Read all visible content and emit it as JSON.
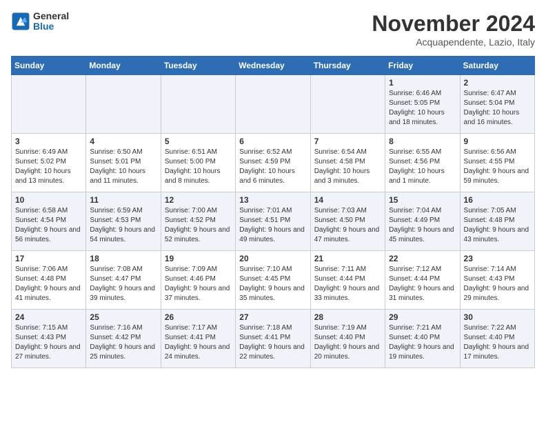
{
  "logo": {
    "line1": "General",
    "line2": "Blue"
  },
  "title": "November 2024",
  "location": "Acquapendente, Lazio, Italy",
  "days_of_week": [
    "Sunday",
    "Monday",
    "Tuesday",
    "Wednesday",
    "Thursday",
    "Friday",
    "Saturday"
  ],
  "weeks": [
    [
      {
        "day": "",
        "info": ""
      },
      {
        "day": "",
        "info": ""
      },
      {
        "day": "",
        "info": ""
      },
      {
        "day": "",
        "info": ""
      },
      {
        "day": "",
        "info": ""
      },
      {
        "day": "1",
        "info": "Sunrise: 6:46 AM\nSunset: 5:05 PM\nDaylight: 10 hours and 18 minutes."
      },
      {
        "day": "2",
        "info": "Sunrise: 6:47 AM\nSunset: 5:04 PM\nDaylight: 10 hours and 16 minutes."
      }
    ],
    [
      {
        "day": "3",
        "info": "Sunrise: 6:49 AM\nSunset: 5:02 PM\nDaylight: 10 hours and 13 minutes."
      },
      {
        "day": "4",
        "info": "Sunrise: 6:50 AM\nSunset: 5:01 PM\nDaylight: 10 hours and 11 minutes."
      },
      {
        "day": "5",
        "info": "Sunrise: 6:51 AM\nSunset: 5:00 PM\nDaylight: 10 hours and 8 minutes."
      },
      {
        "day": "6",
        "info": "Sunrise: 6:52 AM\nSunset: 4:59 PM\nDaylight: 10 hours and 6 minutes."
      },
      {
        "day": "7",
        "info": "Sunrise: 6:54 AM\nSunset: 4:58 PM\nDaylight: 10 hours and 3 minutes."
      },
      {
        "day": "8",
        "info": "Sunrise: 6:55 AM\nSunset: 4:56 PM\nDaylight: 10 hours and 1 minute."
      },
      {
        "day": "9",
        "info": "Sunrise: 6:56 AM\nSunset: 4:55 PM\nDaylight: 9 hours and 59 minutes."
      }
    ],
    [
      {
        "day": "10",
        "info": "Sunrise: 6:58 AM\nSunset: 4:54 PM\nDaylight: 9 hours and 56 minutes."
      },
      {
        "day": "11",
        "info": "Sunrise: 6:59 AM\nSunset: 4:53 PM\nDaylight: 9 hours and 54 minutes."
      },
      {
        "day": "12",
        "info": "Sunrise: 7:00 AM\nSunset: 4:52 PM\nDaylight: 9 hours and 52 minutes."
      },
      {
        "day": "13",
        "info": "Sunrise: 7:01 AM\nSunset: 4:51 PM\nDaylight: 9 hours and 49 minutes."
      },
      {
        "day": "14",
        "info": "Sunrise: 7:03 AM\nSunset: 4:50 PM\nDaylight: 9 hours and 47 minutes."
      },
      {
        "day": "15",
        "info": "Sunrise: 7:04 AM\nSunset: 4:49 PM\nDaylight: 9 hours and 45 minutes."
      },
      {
        "day": "16",
        "info": "Sunrise: 7:05 AM\nSunset: 4:48 PM\nDaylight: 9 hours and 43 minutes."
      }
    ],
    [
      {
        "day": "17",
        "info": "Sunrise: 7:06 AM\nSunset: 4:48 PM\nDaylight: 9 hours and 41 minutes."
      },
      {
        "day": "18",
        "info": "Sunrise: 7:08 AM\nSunset: 4:47 PM\nDaylight: 9 hours and 39 minutes."
      },
      {
        "day": "19",
        "info": "Sunrise: 7:09 AM\nSunset: 4:46 PM\nDaylight: 9 hours and 37 minutes."
      },
      {
        "day": "20",
        "info": "Sunrise: 7:10 AM\nSunset: 4:45 PM\nDaylight: 9 hours and 35 minutes."
      },
      {
        "day": "21",
        "info": "Sunrise: 7:11 AM\nSunset: 4:44 PM\nDaylight: 9 hours and 33 minutes."
      },
      {
        "day": "22",
        "info": "Sunrise: 7:12 AM\nSunset: 4:44 PM\nDaylight: 9 hours and 31 minutes."
      },
      {
        "day": "23",
        "info": "Sunrise: 7:14 AM\nSunset: 4:43 PM\nDaylight: 9 hours and 29 minutes."
      }
    ],
    [
      {
        "day": "24",
        "info": "Sunrise: 7:15 AM\nSunset: 4:43 PM\nDaylight: 9 hours and 27 minutes."
      },
      {
        "day": "25",
        "info": "Sunrise: 7:16 AM\nSunset: 4:42 PM\nDaylight: 9 hours and 25 minutes."
      },
      {
        "day": "26",
        "info": "Sunrise: 7:17 AM\nSunset: 4:41 PM\nDaylight: 9 hours and 24 minutes."
      },
      {
        "day": "27",
        "info": "Sunrise: 7:18 AM\nSunset: 4:41 PM\nDaylight: 9 hours and 22 minutes."
      },
      {
        "day": "28",
        "info": "Sunrise: 7:19 AM\nSunset: 4:40 PM\nDaylight: 9 hours and 20 minutes."
      },
      {
        "day": "29",
        "info": "Sunrise: 7:21 AM\nSunset: 4:40 PM\nDaylight: 9 hours and 19 minutes."
      },
      {
        "day": "30",
        "info": "Sunrise: 7:22 AM\nSunset: 4:40 PM\nDaylight: 9 hours and 17 minutes."
      }
    ]
  ]
}
